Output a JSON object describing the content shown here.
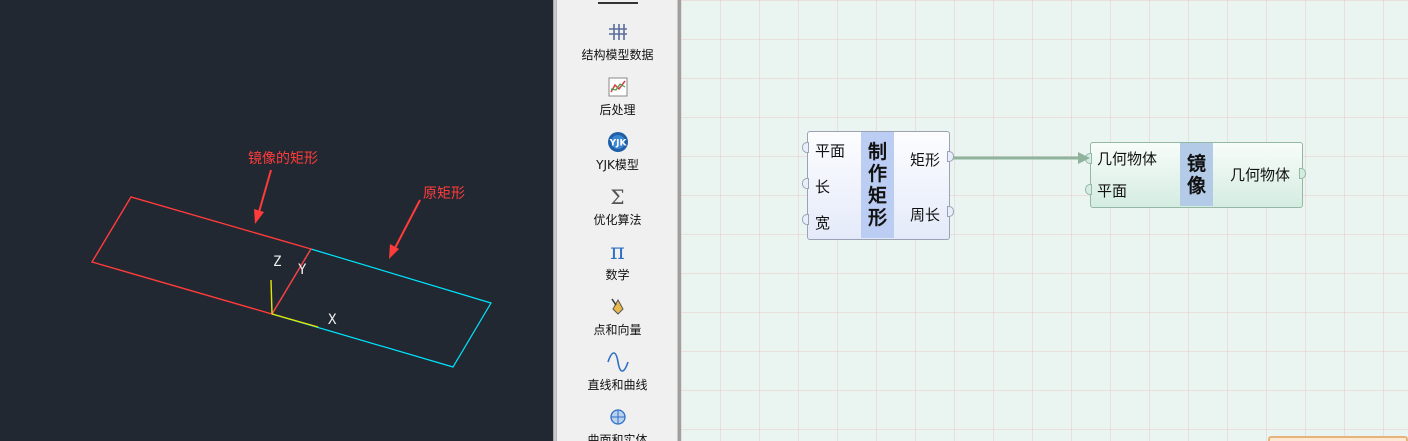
{
  "viewport": {
    "annotations": {
      "mirrored_rect": "镜像的矩形",
      "original_rect": "原矩形"
    },
    "axes": {
      "x": "X",
      "y": "Y",
      "z": "Z"
    },
    "colors": {
      "background": "#222831",
      "mirrored": "#ff3b3b",
      "original": "#00e5ff",
      "annotation": "#ff3b3b",
      "axis_x": "#e6e600",
      "axis_z": "#e6e600"
    }
  },
  "palette": {
    "items": [
      {
        "label": "结构模型数据",
        "icon": "grid-icon"
      },
      {
        "label": "后处理",
        "icon": "chart-icon"
      },
      {
        "label": "YJK模型",
        "icon": "yjk-logo-icon"
      },
      {
        "label": "优化算法",
        "icon": "sigma-icon"
      },
      {
        "label": "数学",
        "icon": "pi-icon"
      },
      {
        "label": "点和向量",
        "icon": "pen-point-icon"
      },
      {
        "label": "直线和曲线",
        "icon": "curve-icon"
      },
      {
        "label": "曲面和实体",
        "icon": "surface-icon"
      }
    ],
    "yjk_badge": "YJK"
  },
  "canvas": {
    "rect_node": {
      "title": [
        "制",
        "作",
        "矩",
        "形"
      ],
      "inputs": [
        "平面",
        "长",
        "宽"
      ],
      "outputs": [
        "矩形",
        "周长"
      ]
    },
    "mirror_node": {
      "title": [
        "镜",
        "像"
      ],
      "inputs": [
        "几何物体",
        "平面"
      ],
      "outputs": [
        "几何物体"
      ]
    },
    "colors": {
      "wire": "#8fb39d",
      "grid": "#e8b4b4",
      "background": "#eaf5f2"
    }
  }
}
